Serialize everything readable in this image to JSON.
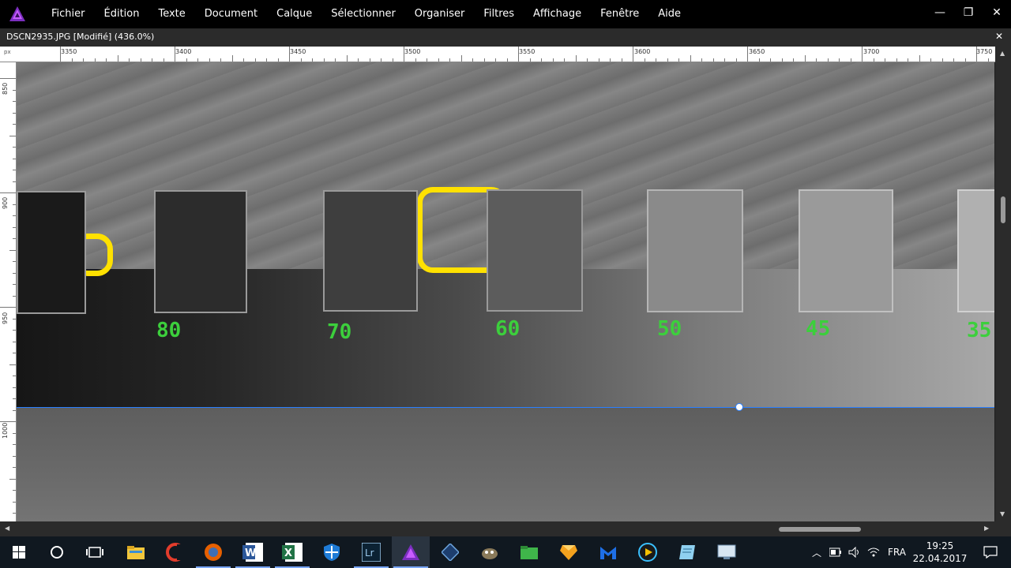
{
  "menu": {
    "items": [
      "Fichier",
      "Édition",
      "Texte",
      "Document",
      "Calque",
      "Sélectionner",
      "Organiser",
      "Filtres",
      "Affichage",
      "Fenêtre",
      "Aide"
    ]
  },
  "window_controls": {
    "minimize": "—",
    "restore": "❐",
    "close": "✕"
  },
  "document": {
    "title": "DSCN2935.JPG [Modifié] (436.0%)",
    "close": "✕"
  },
  "ruler": {
    "unit": "px",
    "h_labels": [
      "3350",
      "3400",
      "3450",
      "3500",
      "3550",
      "3600",
      "3650",
      "3700",
      "3750"
    ],
    "v_labels": [
      "850",
      "900",
      "950",
      "1000"
    ]
  },
  "canvas": {
    "swatch_labels": [
      "80",
      "70",
      "60",
      "50",
      "45",
      "35"
    ],
    "accent_yellow": "#ffe100",
    "label_green": "#3ccf3c",
    "guide_blue": "#2a7fff"
  },
  "taskbar": {
    "icons": [
      "windows-start",
      "cortana-search",
      "task-view",
      "file-explorer",
      "ccleaner",
      "firefox",
      "word",
      "excel",
      "windows-defender",
      "lightroom",
      "affinity-photo",
      "affinity-designer",
      "gimp",
      "green-folder",
      "app-orange-gem",
      "malwarebytes",
      "media-player",
      "notepad-blue",
      "remote-desktop"
    ],
    "language": "FRA",
    "time": "19:25",
    "date": "22.04.2017"
  }
}
